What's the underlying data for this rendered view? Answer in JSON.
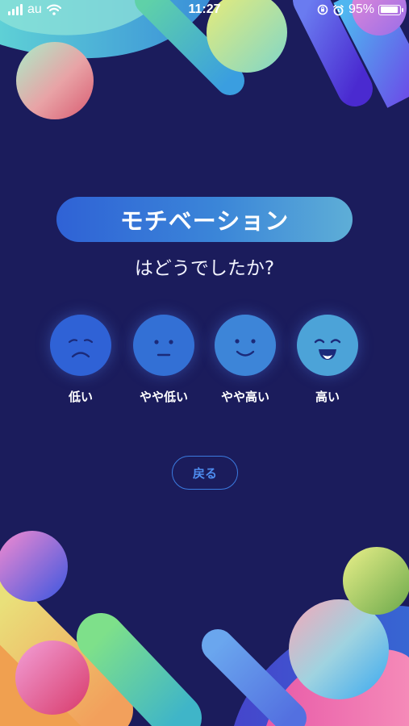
{
  "status_bar": {
    "carrier": "au",
    "time": "11:27",
    "battery": "95%",
    "battery_level": 0.95,
    "icons": [
      "signal-icon",
      "wifi-icon",
      "orientation-lock-icon",
      "alarm-icon",
      "battery-icon"
    ]
  },
  "main": {
    "title": "モチベーション",
    "subtitle": "はどうでしたか?",
    "options": [
      {
        "label": "低い",
        "icon": "sad-face-icon",
        "color": "#2f62d6"
      },
      {
        "label": "やや低い",
        "icon": "neutral-face-icon",
        "color": "#3370d5"
      },
      {
        "label": "やや高い",
        "icon": "smile-face-icon",
        "color": "#3d85d8"
      },
      {
        "label": "高い",
        "icon": "grin-face-icon",
        "color": "#4ca3d8"
      }
    ],
    "back_label": "戻る"
  },
  "colors": {
    "background": "#1b1c5c",
    "accent": "#3b7be0"
  }
}
